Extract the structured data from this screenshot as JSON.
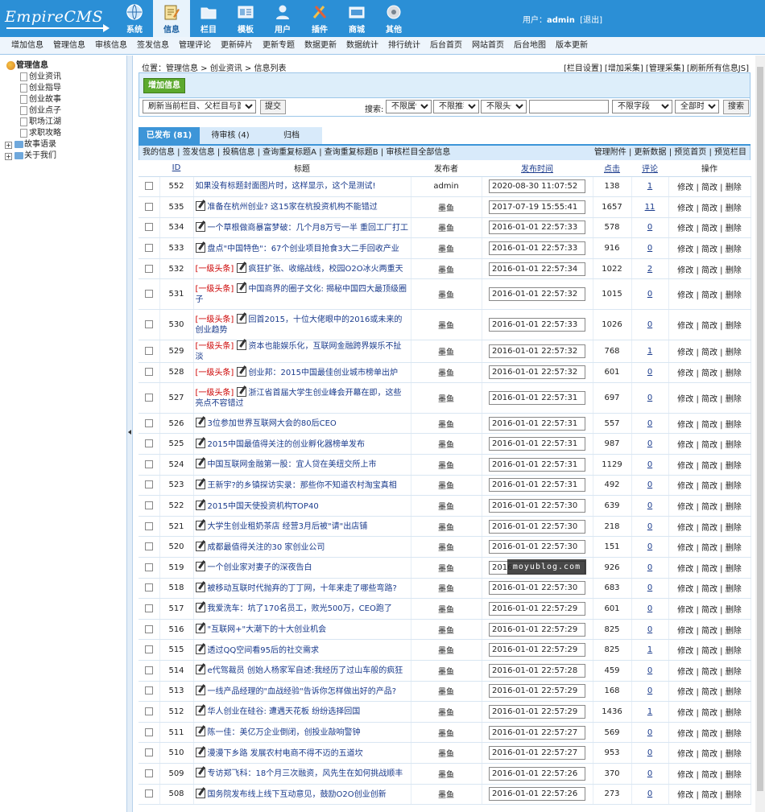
{
  "header": {
    "logo_main": "EmpireCMS",
    "nav": [
      {
        "label": "系统",
        "icon": "globe-icon"
      },
      {
        "label": "信息",
        "icon": "document-edit-icon"
      },
      {
        "label": "栏目",
        "icon": "folder-icon"
      },
      {
        "label": "模板",
        "icon": "template-icon"
      },
      {
        "label": "用户",
        "icon": "user-icon"
      },
      {
        "label": "插件",
        "icon": "tools-icon"
      },
      {
        "label": "商城",
        "icon": "shop-icon"
      },
      {
        "label": "其他",
        "icon": "gear-icon"
      }
    ],
    "user_label": "用户：",
    "user_name": "admin",
    "logout": "[退出]"
  },
  "submenu": [
    "增加信息",
    "管理信息",
    "审核信息",
    "签发信息",
    "管理评论",
    "更新碎片",
    "更新专题",
    "数据更新",
    "数据统计",
    "排行统计",
    "后台首页",
    "网站首页",
    "后台地图",
    "版本更新"
  ],
  "tree": {
    "root": "管理信息",
    "children": [
      "创业资讯",
      "创业指导",
      "创业故事",
      "创业点子",
      "职场江湖",
      "求职攻略"
    ],
    "folders": [
      "故事语录",
      "关于我们"
    ]
  },
  "location": {
    "prefix": "位置：",
    "path": "管理信息 > 创业资讯 > 信息列表",
    "right_links": "[栏目设置] [增加采集] [管理采集] [刷新所有信息JS]"
  },
  "toolbar": {
    "add_button": "增加信息",
    "refresh_select": "刷新当前栏目、父栏目与首页",
    "submit_button": "提交",
    "search_label": "搜索:",
    "filter_attr": "不限属性",
    "filter_recommend": "不限推荐",
    "filter_headline": "不限头条",
    "search_value": "",
    "filter_field": "不限字段",
    "filter_time": "全部时间",
    "search_button": "搜索"
  },
  "tabs": [
    "已发布 (81)",
    "待审核 (4)",
    "归档"
  ],
  "linkbar": {
    "left": "我的信息 | 签发信息 | 投稿信息 | 查询重复标题A | 查询重复标题B | 审核栏目全部信息",
    "right": "管理附件 | 更新数据 | 预览首页 | 预览栏目"
  },
  "table": {
    "headers": {
      "id": "ID",
      "title": "标题",
      "publisher": "发布者",
      "time": "发布时间",
      "clicks": "点击",
      "comments": "评论",
      "ops": "操作"
    },
    "ops_label": "修改 | 简改 | 删除",
    "rows": [
      {
        "id": "552",
        "tag": "",
        "title": "如果没有标题封面图片时，这样显示，这个是测试!",
        "icon": false,
        "publisher": "admin",
        "time": "2020-08-30 11:07:52",
        "clicks": "138",
        "comments": "1",
        "tall": false
      },
      {
        "id": "535",
        "tag": "",
        "title": "准备在杭州创业? 这15家在杭投资机构不能错过",
        "icon": true,
        "publisher": "墨鱼",
        "time": "2017-07-19 15:55:41",
        "clicks": "1657",
        "comments": "11",
        "tall": false
      },
      {
        "id": "534",
        "tag": "",
        "title": "一个草根做商暴富梦破：几个月8万亏一半 重回工厂打工",
        "icon": true,
        "publisher": "墨鱼",
        "time": "2016-01-01 22:57:33",
        "clicks": "578",
        "comments": "0",
        "tall": false
      },
      {
        "id": "533",
        "tag": "",
        "title": "盘点\"中国特色\"：67个创业项目抢食3大二手回收产业",
        "icon": true,
        "publisher": "墨鱼",
        "time": "2016-01-01 22:57:33",
        "clicks": "916",
        "comments": "0",
        "tall": false
      },
      {
        "id": "532",
        "tag": "[一级头条]",
        "title": "疯狂扩张、收缩战线，校园O2O冰火两重天",
        "icon": true,
        "publisher": "墨鱼",
        "time": "2016-01-01 22:57:34",
        "clicks": "1022",
        "comments": "2",
        "tall": false
      },
      {
        "id": "531",
        "tag": "[一级头条]",
        "title": "中国商界的圈子文化: 揭秘中国四大最顶级圈子",
        "icon": true,
        "publisher": "墨鱼",
        "time": "2016-01-01 22:57:32",
        "clicks": "1015",
        "comments": "0",
        "tall": true
      },
      {
        "id": "530",
        "tag": "[一级头条]",
        "title": "回首2015，十位大佬眼中的2016或未来的创业趋势",
        "icon": true,
        "publisher": "墨鱼",
        "time": "2016-01-01 22:57:33",
        "clicks": "1026",
        "comments": "0",
        "tall": true
      },
      {
        "id": "529",
        "tag": "[一级头条]",
        "title": "资本也能娱乐化，互联网金融跨界娱乐不扯淡",
        "icon": true,
        "publisher": "墨鱼",
        "time": "2016-01-01 22:57:32",
        "clicks": "768",
        "comments": "1",
        "tall": false
      },
      {
        "id": "528",
        "tag": "[一级头条]",
        "title": "创业邦：2015中国最佳创业城市榜单出炉",
        "icon": true,
        "publisher": "墨鱼",
        "time": "2016-01-01 22:57:32",
        "clicks": "601",
        "comments": "0",
        "tall": false
      },
      {
        "id": "527",
        "tag": "[一级头条]",
        "title": "浙江省首届大学生创业峰会开幕在即，这些亮点不容错过",
        "icon": true,
        "publisher": "墨鱼",
        "time": "2016-01-01 22:57:31",
        "clicks": "697",
        "comments": "0",
        "tall": true
      },
      {
        "id": "526",
        "tag": "",
        "title": "3位参加世界互联网大会的80后CEO",
        "icon": true,
        "publisher": "墨鱼",
        "time": "2016-01-01 22:57:31",
        "clicks": "557",
        "comments": "0",
        "tall": false
      },
      {
        "id": "525",
        "tag": "",
        "title": "2015中国最值得关注的创业孵化器榜单发布",
        "icon": true,
        "publisher": "墨鱼",
        "time": "2016-01-01 22:57:31",
        "clicks": "987",
        "comments": "0",
        "tall": false
      },
      {
        "id": "524",
        "tag": "",
        "title": "中国互联网金融第一股：宜人贷在美纽交所上市",
        "icon": true,
        "publisher": "墨鱼",
        "time": "2016-01-01 22:57:31",
        "clicks": "1129",
        "comments": "0",
        "tall": false
      },
      {
        "id": "523",
        "tag": "",
        "title": "王新宇?的乡镇探访实录：那些你不知道农村淘宝真相",
        "icon": true,
        "publisher": "墨鱼",
        "time": "2016-01-01 22:57:31",
        "clicks": "492",
        "comments": "0",
        "tall": false
      },
      {
        "id": "522",
        "tag": "",
        "title": "2015中国天使投资机构TOP40",
        "icon": true,
        "publisher": "墨鱼",
        "time": "2016-01-01 22:57:30",
        "clicks": "639",
        "comments": "0",
        "tall": false
      },
      {
        "id": "521",
        "tag": "",
        "title": "大学生创业租奶茶店 经营3月后被\"请\"出店铺",
        "icon": true,
        "publisher": "墨鱼",
        "time": "2016-01-01 22:57:30",
        "clicks": "218",
        "comments": "0",
        "tall": false
      },
      {
        "id": "520",
        "tag": "",
        "title": "成都最值得关注的30 家创业公司",
        "icon": true,
        "publisher": "墨鱼",
        "time": "2016-01-01 22:57:30",
        "clicks": "151",
        "comments": "0",
        "tall": false
      },
      {
        "id": "519",
        "tag": "",
        "title": "一个创业家对妻子的深夜告白",
        "icon": true,
        "publisher": "墨鱼",
        "time": "2016",
        "clicks": "926",
        "comments": "0",
        "tall": false
      },
      {
        "id": "518",
        "tag": "",
        "title": "被移动互联时代抛弃的丁丁网，十年来走了哪些弯路?",
        "icon": true,
        "publisher": "墨鱼",
        "time": "2016-01-01 22:57:30",
        "clicks": "683",
        "comments": "0",
        "tall": false
      },
      {
        "id": "517",
        "tag": "",
        "title": "我爱洗车：坑了170名员工，败光500万，CEO跑了",
        "icon": true,
        "publisher": "墨鱼",
        "time": "2016-01-01 22:57:29",
        "clicks": "601",
        "comments": "0",
        "tall": false
      },
      {
        "id": "516",
        "tag": "",
        "title": "\"互联网+\"大潮下的十大创业机会",
        "icon": true,
        "publisher": "墨鱼",
        "time": "2016-01-01 22:57:29",
        "clicks": "825",
        "comments": "0",
        "tall": false
      },
      {
        "id": "515",
        "tag": "",
        "title": "透过QQ空间看95后的社交需求",
        "icon": true,
        "publisher": "墨鱼",
        "time": "2016-01-01 22:57:29",
        "clicks": "825",
        "comments": "1",
        "tall": false
      },
      {
        "id": "514",
        "tag": "",
        "title": "e代驾裁员 创始人杨家军自述:我经历了过山车般的疯狂",
        "icon": true,
        "publisher": "墨鱼",
        "time": "2016-01-01 22:57:28",
        "clicks": "459",
        "comments": "0",
        "tall": false
      },
      {
        "id": "513",
        "tag": "",
        "title": "一线产品经理的\"血战经验\"告诉你怎样做出好的产品?",
        "icon": true,
        "publisher": "墨鱼",
        "time": "2016-01-01 22:57:29",
        "clicks": "168",
        "comments": "0",
        "tall": false
      },
      {
        "id": "512",
        "tag": "",
        "title": "华人创业在硅谷: 遭遇天花板 纷纷选择回国",
        "icon": true,
        "publisher": "墨鱼",
        "time": "2016-01-01 22:57:29",
        "clicks": "1436",
        "comments": "1",
        "tall": false
      },
      {
        "id": "511",
        "tag": "",
        "title": "陈一佳：美亿万企业倒闭，创投业敲响警钟",
        "icon": true,
        "publisher": "墨鱼",
        "time": "2016-01-01 22:57:27",
        "clicks": "569",
        "comments": "0",
        "tall": false
      },
      {
        "id": "510",
        "tag": "",
        "title": "漫漫下乡路 发展农村电商不得不迈的五道坎",
        "icon": true,
        "publisher": "墨鱼",
        "time": "2016-01-01 22:57:27",
        "clicks": "953",
        "comments": "0",
        "tall": false
      },
      {
        "id": "509",
        "tag": "",
        "title": "专访郑飞科：18个月三次融资，风先生在如何挑战顺丰",
        "icon": true,
        "publisher": "墨鱼",
        "time": "2016-01-01 22:57:26",
        "clicks": "370",
        "comments": "0",
        "tall": false
      },
      {
        "id": "508",
        "tag": "",
        "title": "国务院发布线上线下互动意见，鼓励O2O创业创新",
        "icon": true,
        "publisher": "墨鱼",
        "time": "2016-01-01 22:57:26",
        "clicks": "273",
        "comments": "0",
        "tall": false
      }
    ]
  },
  "watermark": "moyublog.com",
  "colors": {
    "header_bg": "#2b8fd6",
    "tab_active": "#3d95d8",
    "headline_tag": "#cc0000",
    "add_button": "#5ca92e"
  }
}
